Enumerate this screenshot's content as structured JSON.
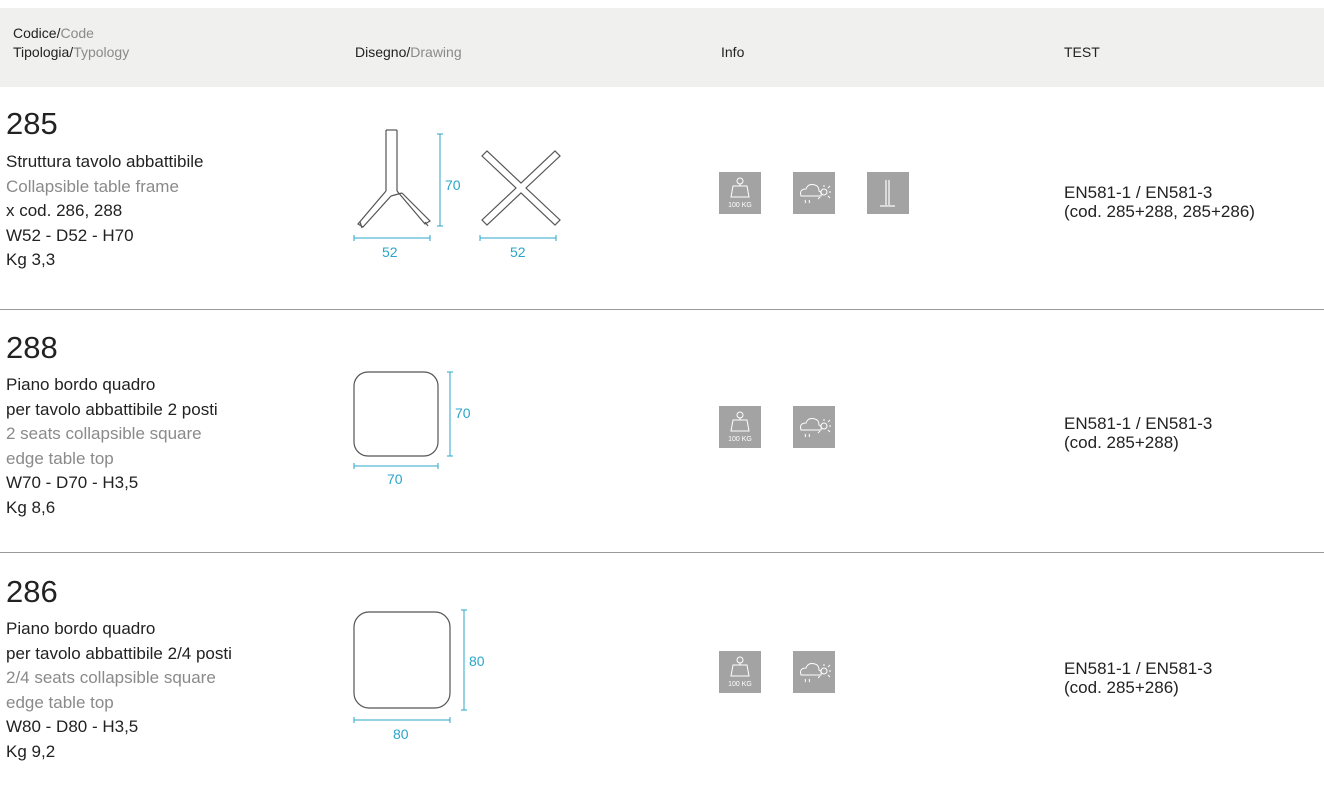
{
  "header": {
    "code_it": "Codice/",
    "code_en": "Code",
    "type_it": "Tipologia/",
    "type_en": "Typology",
    "draw_it": "Disegno/",
    "draw_en": "Drawing",
    "info": "Info",
    "test": "TEST"
  },
  "icons": {
    "weight": "weight-100kg-icon",
    "weight_label": "100 KG",
    "outdoor": "outdoor-weather-icon",
    "stacking": "folding-frame-icon",
    "color": "#a3a3a3"
  },
  "accent_color": "#2aa6c9",
  "products": [
    {
      "code": "285",
      "name_it": "Struttura tavolo abbattibile",
      "name_en": "Collapsible table frame",
      "compat": "x cod. 286, 288",
      "dims": "W52 - D52 - H70",
      "weight": "Kg 3,3",
      "draw_w": "52",
      "draw_h": "70",
      "draw_w2": "52",
      "test_1": "EN581-1 / EN581-3",
      "test_2": "(cod. 285+288, 285+286)"
    },
    {
      "code": "288",
      "name_it_1": "Piano bordo quadro",
      "name_it_2": "per tavolo abbattibile 2 posti",
      "name_en_1": "2 seats collapsible square",
      "name_en_2": "edge table top",
      "dims": "W70 - D70 - H3,5",
      "weight": "Kg 8,6",
      "draw_w": "70",
      "draw_h": "70",
      "test_1": "EN581-1 / EN581-3",
      "test_2": "(cod. 285+288)"
    },
    {
      "code": "286",
      "name_it_1": "Piano bordo quadro",
      "name_it_2": "per tavolo abbattibile 2/4 posti",
      "name_en_1": "2/4 seats collapsible square",
      "name_en_2": "edge table top",
      "dims": "W80 - D80 - H3,5",
      "weight": "Kg 9,2",
      "draw_w": "80",
      "draw_h": "80",
      "test_1": "EN581-1 / EN581-3",
      "test_2": "(cod. 285+286)"
    }
  ]
}
